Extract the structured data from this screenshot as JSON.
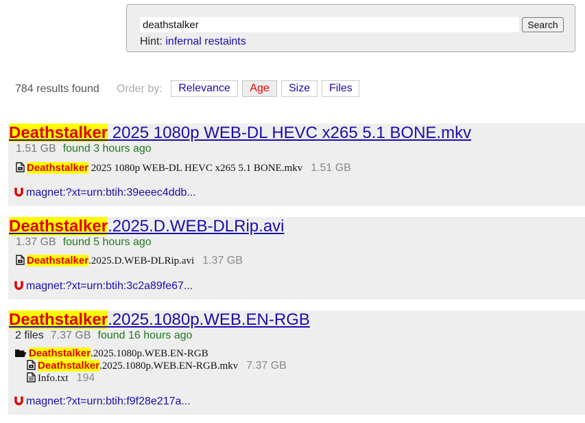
{
  "search": {
    "query": "deathstalker",
    "button_label": "Search",
    "hint_label": "Hint:",
    "hint_link": "infernal restaints"
  },
  "summary": {
    "result_count": "784 results found",
    "order_label": "Order by:",
    "order_options": [
      "Relevance",
      "Age",
      "Size",
      "Files"
    ],
    "active_order": "Age"
  },
  "results": [
    {
      "title_hl": "Deathstalker",
      "title_rest": " 2025 1080p WEB-DL HEVC x265 5.1 BONE.mkv",
      "size": "1.51 GB",
      "found": "found 3 hours ago",
      "file_hl": "Deathstalker",
      "file_rest": " 2025 1080p WEB-DL HEVC x265 5.1 BONE.mkv",
      "file_size": "1.51 GB",
      "magnet": "magnet:?xt=urn:btih:39eeec4ddb..."
    },
    {
      "title_hl": "Deathstalker",
      "title_rest": ".2025.D.WEB-DLRip.avi",
      "size": "1.37 GB",
      "found": "found 5 hours ago",
      "file_hl": "Deathstalker",
      "file_rest": ".2025.D.WEB-DLRip.avi",
      "file_size": "1.37 GB",
      "magnet": "magnet:?xt=urn:btih:3c2a89fe67..."
    },
    {
      "title_hl": "Deathstalker",
      "title_rest": ".2025.1080p.WEB.EN-RGB",
      "files_count": "2 files",
      "size": "7.37 GB",
      "found": "found 16 hours ago",
      "folder_hl": "Deathstalker",
      "folder_rest": ".2025.1080p.WEB.EN-RGB",
      "file1_hl": "Deathstalker",
      "file1_rest": ".2025.1080p.WEB.EN-RGB.mkv",
      "file1_size": "7.37 GB",
      "file2_name": "Info.txt",
      "file2_size": "194",
      "magnet": "magnet:?xt=urn:btih:f9f28e217a..."
    }
  ],
  "colors": {
    "link": "#1a0dab",
    "highlight_bg": "#ffff00",
    "highlight_text": "#e00000",
    "found_text": "#217821",
    "result_bg": "#eeeeee",
    "magnet_icon": "#dd0000"
  },
  "icons": {
    "file": "file-icon",
    "folder": "folder-open-icon",
    "text_file": "text-file-icon",
    "magnet": "magnet-icon"
  }
}
